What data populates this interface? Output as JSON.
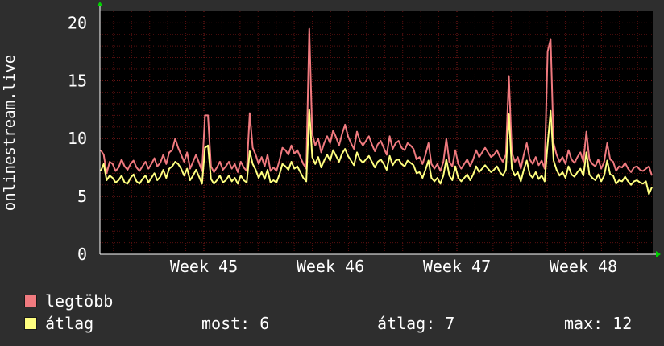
{
  "chart_data": {
    "type": "line",
    "ylabel": "onlinestream.live",
    "ylim": [
      0,
      21
    ],
    "y_ticks": [
      "0",
      "5",
      "10",
      "15",
      "20"
    ],
    "x_ticks": [
      "Week 45",
      "Week 46",
      "Week 47",
      "Week 48"
    ],
    "grid": true,
    "legend_placement": "bottom-left",
    "series": [
      {
        "name": "legtöbb",
        "color": "#f07a7f",
        "values": [
          9,
          8.6,
          7,
          8,
          7.8,
          7.2,
          7.5,
          8.2,
          7.6,
          7.3,
          7.8,
          8.1,
          7.5,
          7.2,
          7.6,
          8,
          7.4,
          7.8,
          8.3,
          7.6,
          7.9,
          8.6,
          7.8,
          8.8,
          9,
          10,
          9.2,
          8.6,
          8,
          8.8,
          7.4,
          8,
          8.6,
          7.9,
          7.2,
          12,
          12,
          7.6,
          7.1,
          7.5,
          8,
          7.3,
          7.6,
          8,
          7.4,
          7.8,
          7.1,
          8,
          7.5,
          7.2,
          12.2,
          9.2,
          8.6,
          7.8,
          8.4,
          7.6,
          8.6,
          7.2,
          7.5,
          7.2,
          8.1,
          9.2,
          9,
          8.6,
          9.4,
          8.7,
          9,
          8.4,
          7.8,
          7.4,
          19.5,
          10.4,
          9.4,
          10,
          8.8,
          9.6,
          10.2,
          9.6,
          10.7,
          10.1,
          9.4,
          10.4,
          11.2,
          10.2,
          9.6,
          9.1,
          10.6,
          9.8,
          9.4,
          9.8,
          10.2,
          9.5,
          8.9,
          9.5,
          9.8,
          9.2,
          8.6,
          10.2,
          9.1,
          9.6,
          9.8,
          9.2,
          9,
          9.6,
          9.4,
          9.1,
          8.2,
          8.4,
          7.8,
          8.6,
          9.6,
          7.8,
          7.4,
          7.8,
          7.2,
          8,
          10,
          8,
          7.6,
          9,
          7.8,
          7.4,
          7.8,
          8.2,
          7.6,
          8.2,
          9,
          8.4,
          8.8,
          9.2,
          8.8,
          8.4,
          8.6,
          9,
          8.4,
          8,
          8.6,
          15.4,
          8.8,
          8,
          8.4,
          7.4,
          8.6,
          9.6,
          8.2,
          7.8,
          8.4,
          7.7,
          8.1,
          7.4,
          17.5,
          18.6,
          9.6,
          8.6,
          8,
          8.4,
          7.8,
          9,
          8.2,
          7.9,
          8.4,
          8.8,
          8,
          10.6,
          8.2,
          7.8,
          7.6,
          8.2,
          7.4,
          8,
          9.6,
          8.2,
          8,
          7.2,
          7.6,
          7.5,
          7.9,
          7.4,
          7.1,
          7.5,
          7.6,
          7.3,
          7.2,
          7.4,
          7.6,
          6.8
        ]
      },
      {
        "name": "átlag",
        "color": "#ffff80",
        "values": [
          7.2,
          7.8,
          6.4,
          6.8,
          6.6,
          6.2,
          6.4,
          6.8,
          6.2,
          6.1,
          6.6,
          6.9,
          6.3,
          6.1,
          6.5,
          6.8,
          6.2,
          6.6,
          7,
          6.4,
          6.7,
          7.3,
          6.6,
          7.4,
          7.6,
          8,
          7.8,
          7.4,
          6.8,
          7.4,
          6.4,
          6.8,
          7.3,
          6.7,
          6.1,
          9.2,
          9.4,
          6.5,
          6.1,
          6.4,
          6.8,
          6.2,
          6.4,
          6.8,
          6.3,
          6.6,
          6.1,
          6.8,
          6.4,
          6.2,
          8.9,
          7.8,
          7.3,
          6.6,
          7.1,
          6.5,
          7.3,
          6.2,
          6.4,
          6.2,
          6.9,
          7.8,
          7.6,
          7.3,
          8,
          7.4,
          7.6,
          7.1,
          6.6,
          6.3,
          12.5,
          8.4,
          7.8,
          8.4,
          7.5,
          8.1,
          8.6,
          8.1,
          9,
          8.5,
          8,
          8.7,
          9.1,
          8.5,
          8.1,
          7.7,
          8.8,
          8.2,
          7.9,
          8.2,
          8.5,
          8,
          7.5,
          8,
          8.2,
          7.8,
          7.3,
          8.5,
          7.7,
          8.1,
          8.2,
          7.8,
          7.6,
          8.1,
          7.9,
          7.7,
          7,
          7.1,
          6.6,
          7.3,
          8.1,
          6.6,
          6.3,
          6.6,
          6.1,
          6.8,
          8.2,
          6.8,
          6.4,
          7.6,
          6.6,
          6.3,
          6.6,
          6.9,
          6.4,
          6.9,
          7.6,
          7.1,
          7.4,
          7.7,
          7.4,
          7.1,
          7.3,
          7.6,
          7.1,
          6.8,
          7.3,
          12.1,
          7.4,
          6.8,
          7.1,
          6.3,
          7.3,
          8.1,
          6.9,
          6.6,
          7.1,
          6.5,
          6.8,
          6.3,
          9.5,
          12.4,
          8.1,
          7.3,
          6.8,
          7.1,
          6.6,
          7.6,
          6.9,
          6.7,
          7.1,
          7.4,
          6.8,
          8.8,
          6.9,
          6.6,
          6.4,
          6.9,
          6.3,
          6.8,
          8.1,
          6.9,
          6.8,
          6.1,
          6.4,
          6.3,
          6.7,
          6.3,
          6,
          6.3,
          6.4,
          6.2,
          6.1,
          6.3,
          5.2,
          5.8
        ]
      }
    ]
  },
  "legend": {
    "items": [
      {
        "label": "legtöbb",
        "color": "#f07a7f"
      },
      {
        "label": "átlag",
        "color": "#ffff80"
      }
    ]
  },
  "stats": {
    "now_label": "most:",
    "now_value": "6",
    "avg_label": "átlag:",
    "avg_value": "7",
    "max_label": "max:",
    "max_value": "12"
  },
  "colors": {
    "background": "#2e2e2e",
    "plot_area": "#000000",
    "grid_minor": "#5a1010",
    "grid_major": "#8a1c1c",
    "axis_arrow": "#00d000"
  }
}
